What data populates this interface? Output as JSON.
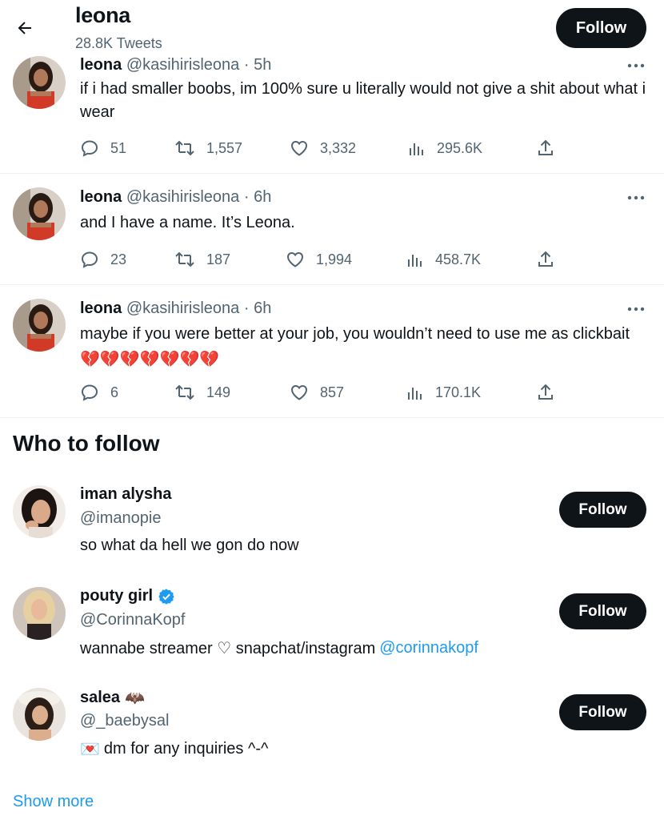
{
  "header": {
    "name": "leona",
    "tweet_count": "28.8K Tweets",
    "follow_label": "Follow"
  },
  "tweets": [
    {
      "name": "leona",
      "handle": "@kasihirisleona",
      "time": "· 5h",
      "text": "if i had smaller boobs, im 100% sure u literally would not give a shit about what i wear",
      "emoji": "",
      "replies": "51",
      "retweets": "1,557",
      "likes": "3,332",
      "views": "295.6K"
    },
    {
      "name": "leona",
      "handle": "@kasihirisleona",
      "time": "· 6h",
      "text": "and I have a name. It’s Leona.",
      "emoji": "",
      "replies": "23",
      "retweets": "187",
      "likes": "1,994",
      "views": "458.7K"
    },
    {
      "name": "leona",
      "handle": "@kasihirisleona",
      "time": "· 6h",
      "text": "maybe if you were better at your job, you wouldn’t need to use me as clickbait",
      "emoji": "💔💔💔💔💔💔💔",
      "replies": "6",
      "retweets": "149",
      "likes": "857",
      "views": "170.1K"
    }
  ],
  "who_to_follow": {
    "title": "Who to follow",
    "accounts": [
      {
        "name": "iman alysha",
        "handle": "@imanopie",
        "bio": "so what da hell we gon do now",
        "bio_prefix": "",
        "bio_link": "",
        "verified": false,
        "name_emoji": "",
        "follow_label": "Follow"
      },
      {
        "name": "pouty girl",
        "handle": "@CorinnaKopf",
        "bio": "wannabe streamer ♡ snapchat/instagram",
        "bio_prefix": "",
        "bio_link": "@corinnakopf",
        "verified": true,
        "name_emoji": "",
        "follow_label": "Follow"
      },
      {
        "name": "salea",
        "handle": "@_baebysal",
        "bio": "dm for any inquiries ^-^",
        "bio_prefix": "💌",
        "bio_link": "",
        "verified": false,
        "name_emoji": "🦇",
        "follow_label": "Follow"
      }
    ]
  },
  "show_more": "Show more",
  "colors": {
    "text": "#0f1419",
    "secondary": "#536471",
    "accent": "#1d9bf0",
    "button": "#0f1419",
    "divider": "#eff3f4"
  },
  "icons": {
    "back": "arrow-left-icon",
    "reply": "reply-icon",
    "retweet": "retweet-icon",
    "like": "heart-icon",
    "views": "analytics-icon",
    "share": "share-icon",
    "more": "more-dots-icon",
    "verified": "verified-badge-icon"
  }
}
